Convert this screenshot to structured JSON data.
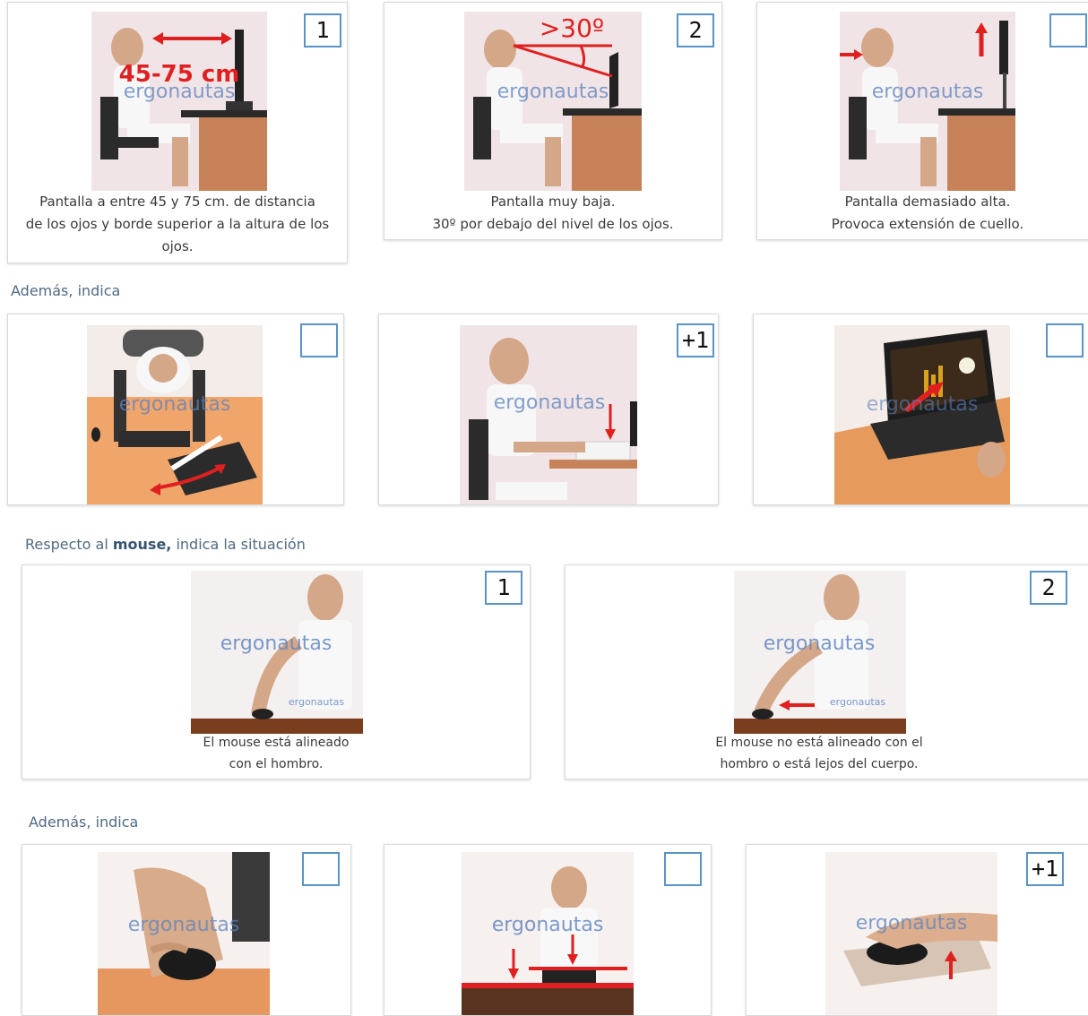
{
  "watermark": "ergonautas",
  "sections": {
    "ademas_1": "Además, indica",
    "mouse_prefix": "Respecto al ",
    "mouse_bold": "mouse,",
    "mouse_suffix": " indica la situación",
    "ademas_2": "Además, indica"
  },
  "screen_row": [
    {
      "box": "1",
      "overlay": "45-75 cm",
      "caption": [
        "Pantalla a entre 45 y 75 cm. de distancia",
        "de los ojos y borde superior a la altura de los",
        "ojos."
      ]
    },
    {
      "box": "2",
      "overlay": ">30º",
      "caption": [
        "Pantalla muy baja.",
        "30º por debajo del nivel de los ojos."
      ]
    },
    {
      "box": "",
      "caption": [
        "Pantalla demasiado alta.",
        "Provoca extensión de cuello."
      ]
    }
  ],
  "screen_extra_row": [
    {
      "box": ""
    },
    {
      "box": "+1"
    },
    {
      "box": ""
    }
  ],
  "mouse_row": [
    {
      "box": "1",
      "caption": [
        "El mouse está alineado",
        "con el hombro."
      ]
    },
    {
      "box": "2",
      "caption": [
        "El mouse no está alineado con el",
        "hombro o está lejos del cuerpo."
      ]
    }
  ],
  "mouse_extra_row": [
    {
      "box": ""
    },
    {
      "box": ""
    },
    {
      "box": "+1"
    }
  ],
  "colors": {
    "box_border": "#5a93c7",
    "arrow": "#e02020",
    "section_text": "#4f6a82",
    "watermark": "#5b82bf"
  }
}
